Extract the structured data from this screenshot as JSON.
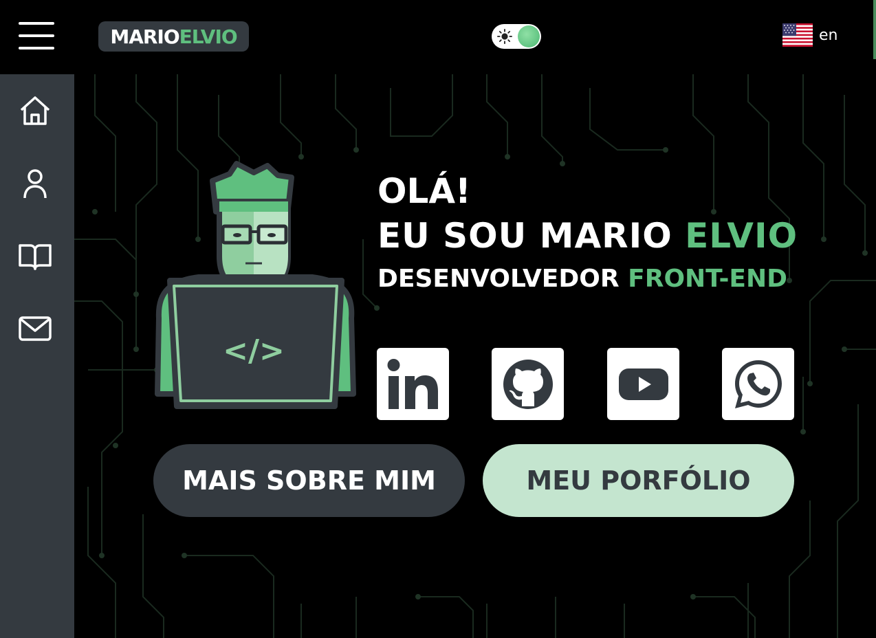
{
  "header": {
    "menu_icon": "hamburger-menu-icon",
    "logo": {
      "first": "MARIO",
      "second": "ELVIO"
    },
    "theme_toggle": {
      "icon": "sun-icon",
      "state": "dark"
    },
    "language": {
      "flag": "us-flag-icon",
      "label": "en"
    }
  },
  "sidebar": {
    "items": [
      {
        "icon": "home-icon"
      },
      {
        "icon": "user-icon"
      },
      {
        "icon": "book-icon"
      },
      {
        "icon": "mail-icon"
      }
    ]
  },
  "hero": {
    "greeting": "OLÁ!",
    "intro": "EU SOU MARIO ",
    "name_highlight": "ELVIO",
    "role": "DESENVOLVEDOR ",
    "role_highlight": "FRONT-END",
    "avatar_code": "</>"
  },
  "socials": [
    {
      "icon": "linkedin-icon"
    },
    {
      "icon": "github-icon"
    },
    {
      "icon": "youtube-icon"
    },
    {
      "icon": "whatsapp-icon"
    }
  ],
  "buttons": {
    "about": "MAIS SOBRE MIM",
    "portfolio": "MEU PORFÓLIO"
  },
  "colors": {
    "accent": "#5fbf7f",
    "dark": "#343a40",
    "light_green": "#c4e5cf",
    "background": "#000000"
  }
}
